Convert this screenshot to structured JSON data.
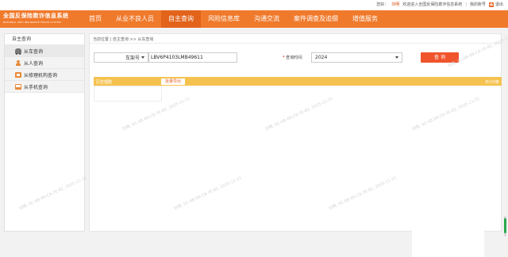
{
  "topbar": {
    "greeting": "您好：",
    "username": "刘明",
    "welcome": "欢迎进入全国反保险欺诈信息系统",
    "separator": "|",
    "my_account": "我的账号",
    "exit_label": "退出"
  },
  "header": {
    "logo_title": "全国反保险欺诈信息系统",
    "logo_subtitle": "NATIONAL ANTI INSURANCE FRAUD SYSTEM",
    "nav": [
      {
        "label": "首页"
      },
      {
        "label": "从业不良人员"
      },
      {
        "label": "自主查询"
      },
      {
        "label": "风险信息库"
      },
      {
        "label": "沟通交流"
      },
      {
        "label": "案件调查及追偿"
      },
      {
        "label": "增值服务"
      }
    ]
  },
  "sidebar": {
    "title": "自主查询",
    "items": [
      {
        "label": "从车查询",
        "icon": "car-icon"
      },
      {
        "label": "从人查询",
        "icon": "person-icon"
      },
      {
        "label": "从修理机构查询",
        "icon": "organization-icon"
      },
      {
        "label": "从手机查询",
        "icon": "phone-icon"
      }
    ]
  },
  "main": {
    "breadcrumb": "当前位置 | 自主查询 >> 从车查询",
    "search": {
      "type_value": "车架号",
      "input_value": "LBV6P4103LMB49611",
      "time_required": "*",
      "time_label": "查询时间:",
      "year_value": "2024",
      "query_button": "查 询"
    },
    "results": {
      "label": "历史理赔",
      "export_button": "批量导出",
      "count": "共计0条"
    }
  },
  "watermark_text": "刘明, 0C-4B-89-C9-7E-82, 2025-11-21",
  "colors": {
    "brand_orange": "#f07a2c",
    "nav_active": "#e2631a",
    "query_button": "#f0542c",
    "result_bar": "#f6c24f",
    "scroll_thumb": "#2aa84a"
  }
}
